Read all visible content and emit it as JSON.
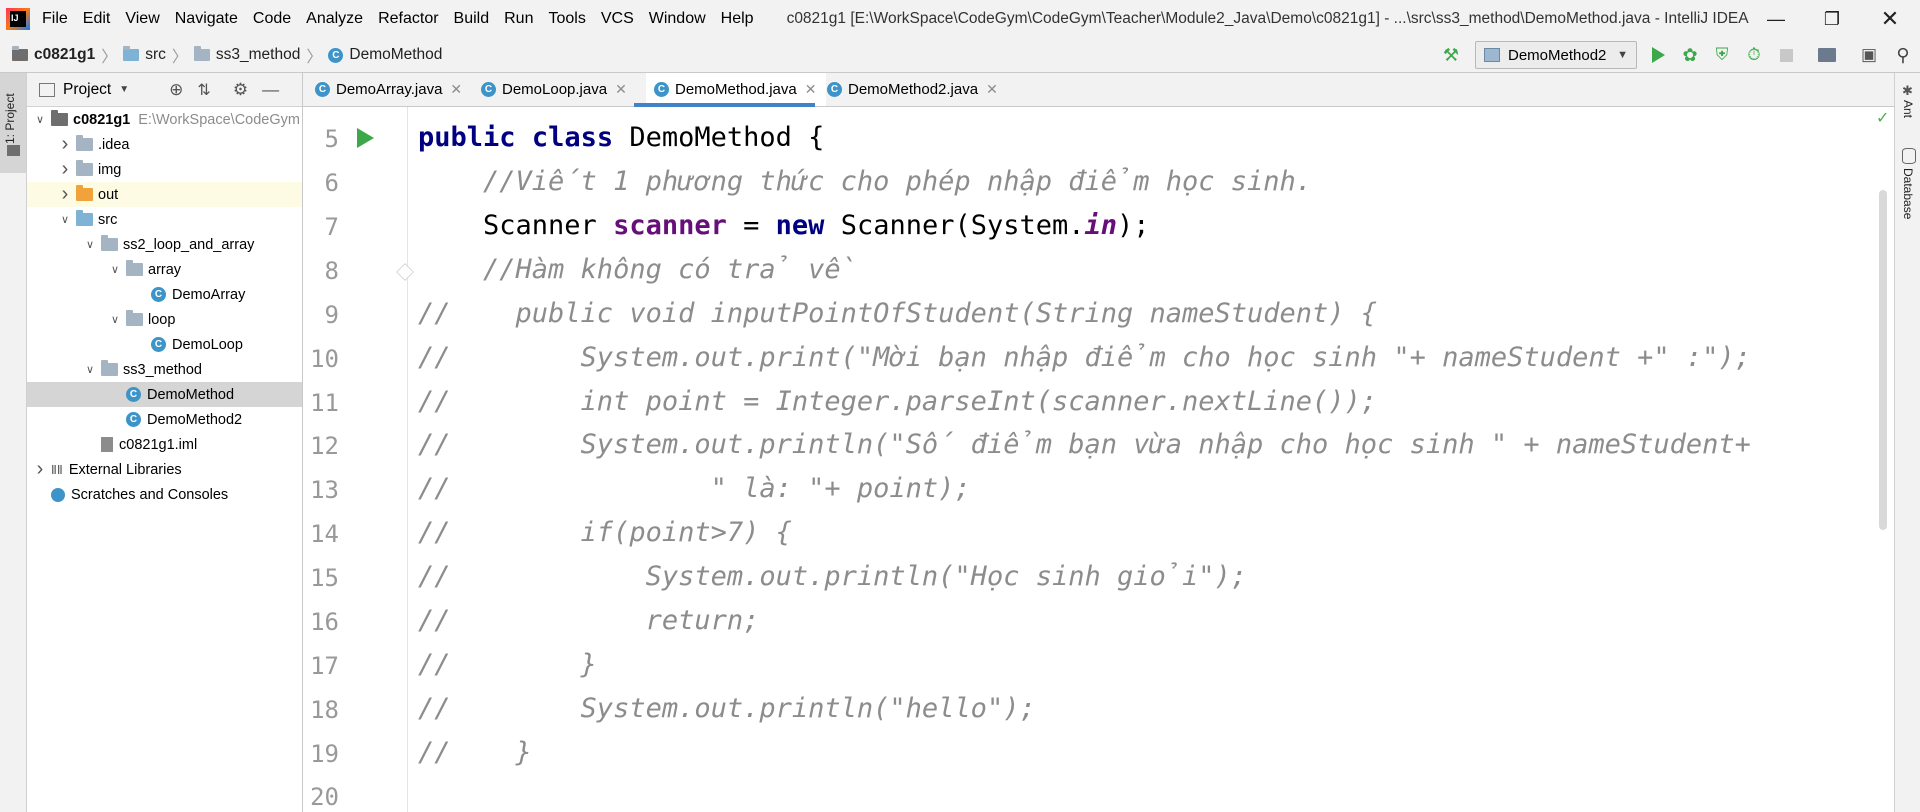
{
  "menu": [
    "File",
    "Edit",
    "View",
    "Navigate",
    "Code",
    "Analyze",
    "Refactor",
    "Build",
    "Run",
    "Tools",
    "VCS",
    "Window",
    "Help"
  ],
  "window_title": "c0821g1 [E:\\WorkSpace\\CodeGym\\CodeGym\\Teacher\\Module2_Java\\Demo\\c0821g1] - ...\\src\\ss3_method\\DemoMethod.java - IntelliJ IDEA",
  "breadcrumb": [
    "c0821g1",
    "src",
    "ss3_method",
    "DemoMethod"
  ],
  "run_config": "DemoMethod2",
  "project_panel": {
    "title": "Project",
    "tree": [
      {
        "label": "c0821g1",
        "extra": "E:\\WorkSpace\\CodeGym",
        "type": "module",
        "depth": 0,
        "arrow": "down"
      },
      {
        "label": ".idea",
        "type": "folder",
        "depth": 1,
        "arrow": "right"
      },
      {
        "label": "img",
        "type": "folder",
        "depth": 1,
        "arrow": "right"
      },
      {
        "label": "out",
        "type": "folder-orange",
        "depth": 1,
        "arrow": "right"
      },
      {
        "label": "src",
        "type": "folder-blue",
        "depth": 1,
        "arrow": "down"
      },
      {
        "label": "ss2_loop_and_array",
        "type": "package",
        "depth": 2,
        "arrow": "down"
      },
      {
        "label": "array",
        "type": "package",
        "depth": 3,
        "arrow": "down"
      },
      {
        "label": "DemoArray",
        "type": "class",
        "depth": 4,
        "arrow": ""
      },
      {
        "label": "loop",
        "type": "package",
        "depth": 3,
        "arrow": "down"
      },
      {
        "label": "DemoLoop",
        "type": "class",
        "depth": 4,
        "arrow": ""
      },
      {
        "label": "ss3_method",
        "type": "package",
        "depth": 2,
        "arrow": "down"
      },
      {
        "label": "DemoMethod",
        "type": "class",
        "depth": 3,
        "arrow": "",
        "selected": true
      },
      {
        "label": "DemoMethod2",
        "type": "class",
        "depth": 3,
        "arrow": ""
      },
      {
        "label": "c0821g1.iml",
        "type": "iml",
        "depth": 2,
        "arrow": ""
      },
      {
        "label": "External Libraries",
        "type": "libs",
        "depth": 0,
        "arrow": "right"
      },
      {
        "label": "Scratches and Consoles",
        "type": "scratch",
        "depth": 0,
        "arrow": ""
      }
    ]
  },
  "tabs": [
    {
      "label": "DemoArray.java",
      "active": false
    },
    {
      "label": "DemoLoop.java",
      "active": false
    },
    {
      "label": "DemoMethod.java",
      "active": true
    },
    {
      "label": "DemoMethod2.java",
      "active": false
    }
  ],
  "line_numbers": [
    "5",
    "6",
    "7",
    "8",
    "9",
    "10",
    "11",
    "12",
    "13",
    "14",
    "15",
    "16",
    "17",
    "18",
    "19",
    "20"
  ],
  "code": {
    "l5_kw1": "public",
    "l5_kw2": "class",
    "l5_name": " DemoMethod {",
    "l6": "    //Viết 1 phương thức cho phép nhập điểm học sinh.",
    "l7_type": "    Scanner ",
    "l7_var": "scanner",
    "l7_eq": " = ",
    "l7_new": "new",
    "l7_ctor": " Scanner(System.",
    "l7_in": "in",
    "l7_end": ");",
    "l8": "    //Hàm không có trả về",
    "l9": "//    public void inputPointOfStudent(String nameStudent) {",
    "l10": "//        System.out.print(\"Mời bạn nhập điểm cho học sinh \"+ nameStudent +\" :\");",
    "l11": "//        int point = Integer.parseInt(scanner.nextLine());",
    "l12": "//        System.out.println(\"Số điểm bạn vừa nhập cho học sinh \" + nameStudent+",
    "l13": "//                \" là: \"+ point);",
    "l14": "//        if(point>7) {",
    "l15": "//            System.out.println(\"Học sinh giỏi\");",
    "l16": "//            return;",
    "l17": "//        }",
    "l18": "//        System.out.println(\"hello\");",
    "l19": "//    }"
  },
  "side_tools": {
    "left": "1: Project",
    "right_ant": "Ant",
    "right_db": "Database"
  }
}
